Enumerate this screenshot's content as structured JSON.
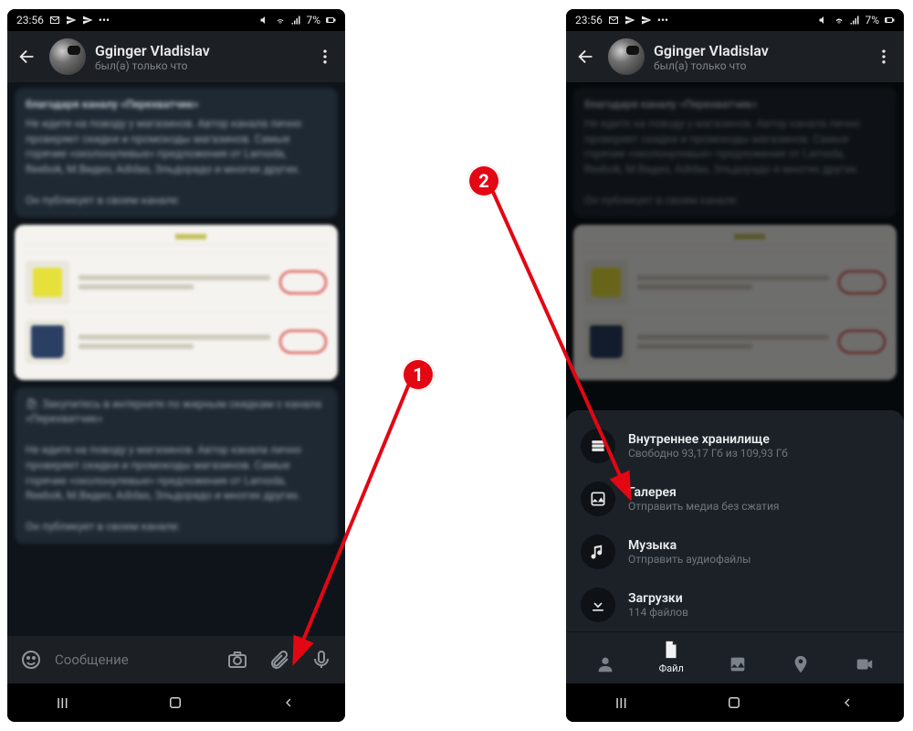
{
  "status": {
    "time": "23:56",
    "battery": "7%"
  },
  "chat": {
    "name": "Gginger Vladislav",
    "last_seen": "был(а) только что"
  },
  "input": {
    "placeholder": "Сообщение"
  },
  "attach": {
    "items": [
      {
        "title": "Внутреннее хранилище",
        "sub": "Свободно 93,17 Гб из 109,93 Гб",
        "icon": "storage-icon"
      },
      {
        "title": "Галерея",
        "sub": "Отправить медиа без сжатия",
        "icon": "gallery-icon"
      },
      {
        "title": "Музыка",
        "sub": "Отправить аудиофайлы",
        "icon": "music-icon"
      },
      {
        "title": "Загрузки",
        "sub": "114 файлов",
        "icon": "download-icon"
      }
    ],
    "bottom": {
      "contact": "",
      "file": "Файл",
      "gallery": "",
      "location": "",
      "video": ""
    }
  },
  "markers": {
    "one": "1",
    "two": "2"
  }
}
